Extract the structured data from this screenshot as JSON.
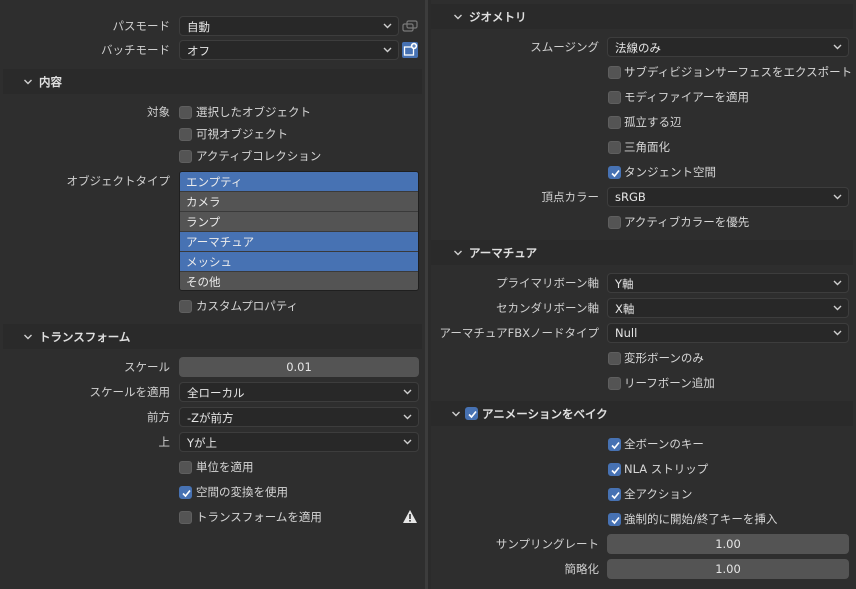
{
  "left": {
    "path_mode": {
      "label": "パスモード",
      "value": "自動"
    },
    "batch_mode": {
      "label": "バッチモード",
      "value": "オフ"
    },
    "content": {
      "title": "内容",
      "target_label": "対象",
      "checks": [
        {
          "label": "選択したオブジェクト",
          "checked": false
        },
        {
          "label": "可視オブジェクト",
          "checked": false
        },
        {
          "label": "アクティブコレクション",
          "checked": false
        }
      ],
      "object_type_label": "オブジェクトタイプ",
      "object_types": [
        {
          "label": "エンプティ",
          "selected": true
        },
        {
          "label": "カメラ",
          "selected": false
        },
        {
          "label": "ランプ",
          "selected": false
        },
        {
          "label": "アーマチュア",
          "selected": true
        },
        {
          "label": "メッシュ",
          "selected": true
        },
        {
          "label": "その他",
          "selected": false
        }
      ],
      "custom_props": {
        "label": "カスタムプロパティ",
        "checked": false
      }
    },
    "transform": {
      "title": "トランスフォーム",
      "scale": {
        "label": "スケール",
        "value": "0.01"
      },
      "apply_scale": {
        "label": "スケールを適用",
        "value": "全ローカル"
      },
      "forward": {
        "label": "前方",
        "value": "-Zが前方"
      },
      "up": {
        "label": "上",
        "value": "Yが上"
      },
      "apply_unit": {
        "label": "単位を適用",
        "checked": false
      },
      "use_space_transform": {
        "label": "空間の変換を使用",
        "checked": true
      },
      "apply_transform": {
        "label": "トランスフォームを適用",
        "checked": false
      }
    }
  },
  "right": {
    "geometry": {
      "title": "ジオメトリ",
      "smoothing": {
        "label": "スムージング",
        "value": "法線のみ"
      },
      "checks": [
        {
          "label": "サブディビジョンサーフェスをエクスポート",
          "checked": false
        },
        {
          "label": "モディファイアーを適用",
          "checked": false
        },
        {
          "label": "孤立する辺",
          "checked": false
        },
        {
          "label": "三角面化",
          "checked": false
        },
        {
          "label": "タンジェント空間",
          "checked": true
        }
      ],
      "vertex_color": {
        "label": "頂点カラー",
        "value": "sRGB"
      },
      "prioritize_active_color": {
        "label": "アクティブカラーを優先",
        "checked": false
      }
    },
    "armature": {
      "title": "アーマチュア",
      "primary_bone_axis": {
        "label": "プライマリボーン軸",
        "value": "Y軸"
      },
      "secondary_bone_axis": {
        "label": "セカンダリボーン軸",
        "value": "X軸"
      },
      "fbx_node_type": {
        "label": "アーマチュアFBXノードタイプ",
        "value": "Null"
      },
      "deform_only": {
        "label": "変形ボーンのみ",
        "checked": false
      },
      "add_leaf": {
        "label": "リーフボーン追加",
        "checked": false
      }
    },
    "bake_animation": {
      "title": "アニメーションをベイク",
      "checked": true,
      "checks": [
        {
          "label": "全ボーンのキー",
          "checked": true
        },
        {
          "label": "NLA ストリップ",
          "checked": true
        },
        {
          "label": "全アクション",
          "checked": true
        },
        {
          "label": "強制的に開始/終了キーを挿入",
          "checked": true
        }
      ],
      "sampling_rate": {
        "label": "サンプリングレート",
        "value": "1.00"
      },
      "simplify": {
        "label": "簡略化",
        "value": "1.00"
      }
    }
  },
  "colors": {
    "accent": "#4772b3",
    "panel_bg": "#2e2e2e",
    "header_bg": "#2a2a2a",
    "field_bg": "#545454"
  },
  "icons": [
    "chevron-down-icon",
    "checkmark-icon",
    "warning-icon",
    "new-preset-icon",
    "link-icon"
  ]
}
